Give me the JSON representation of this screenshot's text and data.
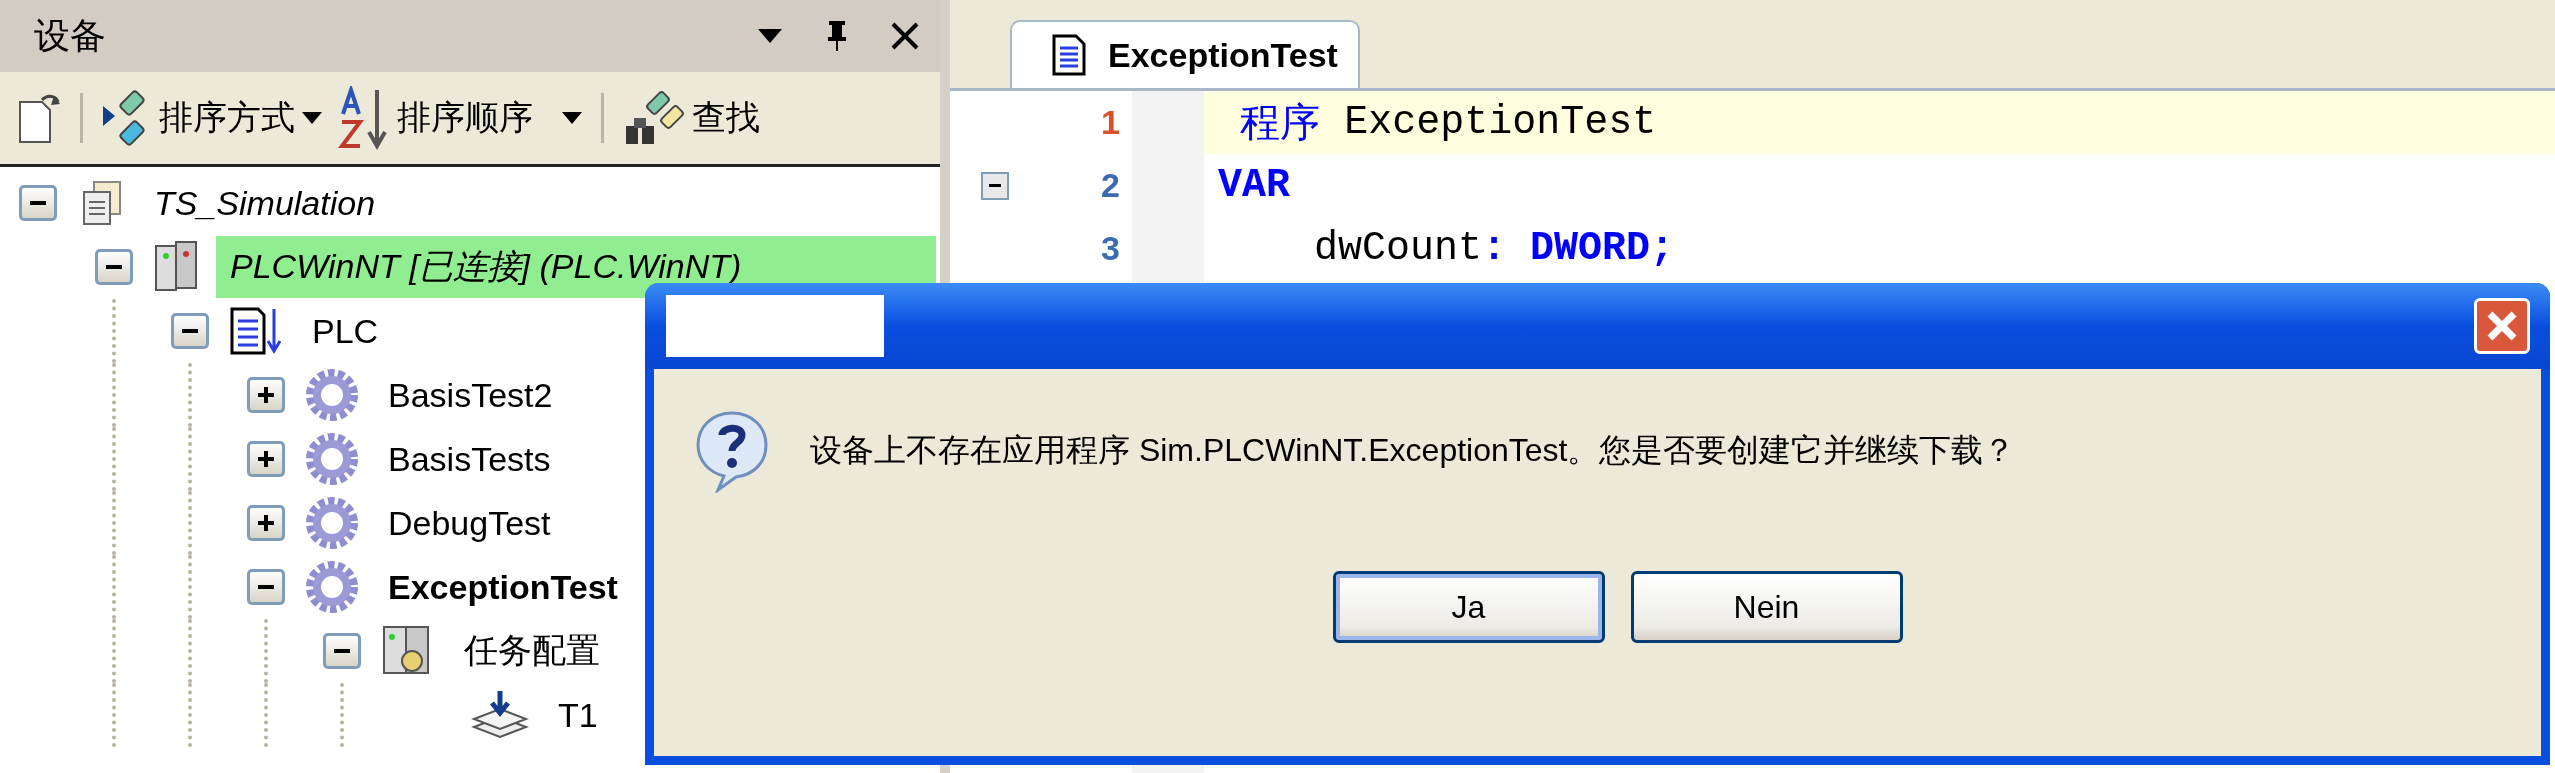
{
  "devices_panel": {
    "title": "设备",
    "toolbar": [
      {
        "kind": "new"
      },
      {
        "kind": "sort-by",
        "label": "排序方式"
      },
      {
        "kind": "sort-order",
        "label": "排序顺序"
      },
      {
        "kind": "find",
        "label": "查找"
      }
    ],
    "tree": [
      {
        "label": "TS_Simulation",
        "kind": "project",
        "expanded": true,
        "highlighted": false,
        "active": false,
        "children": [
          {
            "label": "PLCWinNT [已连接] (PLC.WinNT)",
            "kind": "device",
            "expanded": true,
            "highlighted": true,
            "active": false,
            "children": [
              {
                "label": "PLC",
                "kind": "plc",
                "expanded": true,
                "highlighted": false,
                "active": false,
                "children": [
                  {
                    "label": "BasisTest2",
                    "kind": "application",
                    "expanded": false,
                    "highlighted": false,
                    "active": false
                  },
                  {
                    "label": "BasisTests",
                    "kind": "application",
                    "expanded": false,
                    "highlighted": false,
                    "active": false
                  },
                  {
                    "label": "DebugTest",
                    "kind": "application",
                    "expanded": false,
                    "highlighted": false,
                    "active": false
                  },
                  {
                    "label": "ExceptionTest",
                    "kind": "application",
                    "expanded": true,
                    "highlighted": false,
                    "active": true,
                    "children": [
                      {
                        "label": "任务配置",
                        "kind": "task-config",
                        "expanded": true,
                        "highlighted": false,
                        "active": false,
                        "children": [
                          {
                            "label": "T1",
                            "kind": "task",
                            "highlighted": false,
                            "active": false
                          }
                        ]
                      }
                    ]
                  }
                ]
              }
            ]
          }
        ]
      }
    ]
  },
  "editor": {
    "tabs": [
      {
        "label": "ExceptionTest",
        "selected": true
      }
    ],
    "lines": [
      {
        "number": "1",
        "current": true,
        "foldable": false,
        "tokens": [
          {
            "text": "  程序",
            "kind": "label"
          },
          {
            "text": " ExceptionTest",
            "kind": "plain"
          }
        ]
      },
      {
        "number": "2",
        "current": false,
        "foldable": true,
        "tokens": [
          {
            "text": "VAR",
            "kind": "keyword"
          }
        ]
      },
      {
        "number": "3",
        "current": false,
        "foldable": false,
        "tokens": [
          {
            "text": "    dwCount",
            "kind": "plain"
          },
          {
            "text": ": DWORD;",
            "kind": "keyword"
          }
        ]
      }
    ]
  },
  "dialog": {
    "message": "设备上不存在应用程序 Sim.PLCWinNT.ExceptionTest。您是否要创建它并继续下载？",
    "buttons": [
      {
        "label": "Ja",
        "default": true
      },
      {
        "label": "Nein",
        "default": false
      }
    ]
  }
}
